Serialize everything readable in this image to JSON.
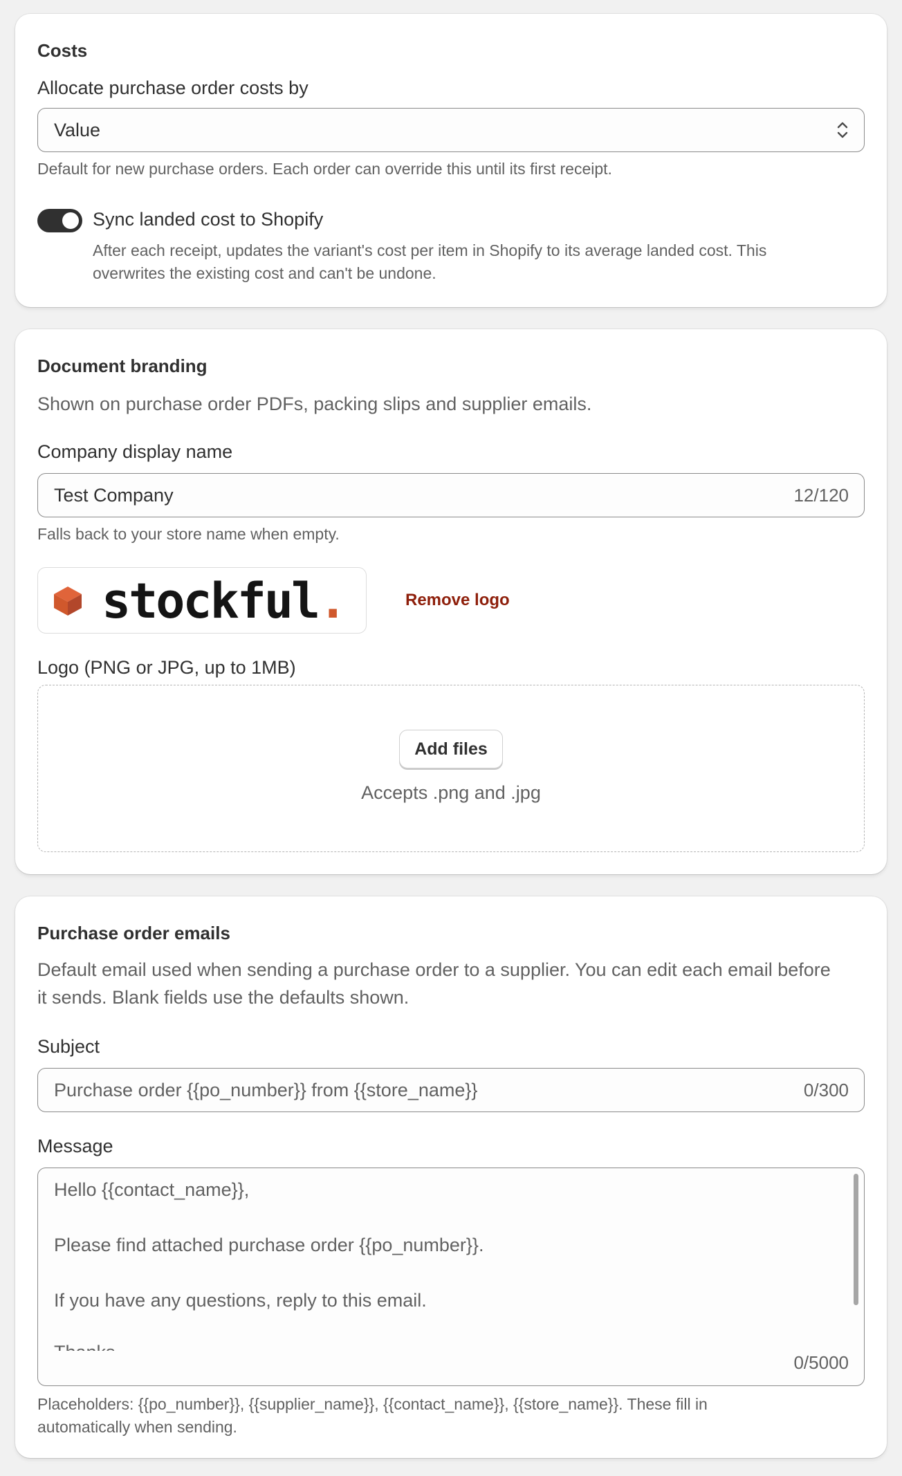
{
  "costs": {
    "title": "Costs",
    "allocate_label": "Allocate purchase order costs by",
    "allocate_value": "Value",
    "allocate_help": "Default for new purchase orders. Each order can override this until its first receipt.",
    "sync_enabled": true,
    "sync_label": "Sync landed cost to Shopify",
    "sync_help_line1": "After each receipt, updates the variant's cost per item in Shopify to its average landed cost. This",
    "sync_help_line2": "overwrites the existing cost and can't be undone."
  },
  "branding": {
    "title": "Document branding",
    "description": "Shown on purchase order PDFs, packing slips and supplier emails.",
    "company_label": "Company display name",
    "company_value": "Test Company",
    "company_count": "12/120",
    "company_help": "Falls back to your store name when empty.",
    "logo_word": "stockful",
    "logo_dot": ".",
    "remove_logo_label": "Remove logo",
    "logo_label": "Logo (PNG or JPG, up to 1MB)",
    "add_files_label": "Add files",
    "accepts_text": "Accepts .png and .jpg",
    "logo_colors": {
      "top": "#e0643a",
      "left": "#d0582c",
      "right": "#b2472b"
    }
  },
  "emails": {
    "title": "Purchase order emails",
    "description_line1": "Default email used when sending a purchase order to a supplier. You can edit each email before",
    "description_line2": "it sends. Blank fields use the defaults shown.",
    "subject_label": "Subject",
    "subject_placeholder": "Purchase order {{po_number}} from {{store_name}}",
    "subject_count": "0/300",
    "message_label": "Message",
    "message_lines": [
      "Hello {{contact_name}},",
      "Please find attached purchase order {{po_number}}.",
      "If you have any questions, reply to this email.",
      "Thanks"
    ],
    "message_count": "0/5000",
    "placeholders_help_line1": "Placeholders: {{po_number}}, {{supplier_name}}, {{contact_name}}, {{store_name}}. These fill in",
    "placeholders_help_line2": "automatically when sending."
  }
}
